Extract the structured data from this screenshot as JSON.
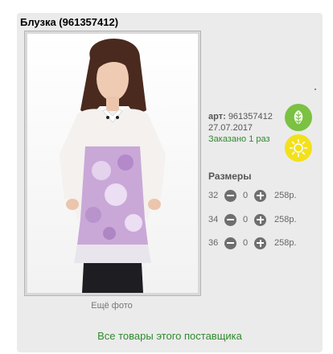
{
  "product": {
    "title": "Блузка (961357412)",
    "more_photos": "Ещё фото",
    "art_label": "арт:",
    "art_value": "961357412",
    "date": "27.07.2017",
    "ordered": "Заказано 1 раз"
  },
  "badges": [
    {
      "icon": "leaf-icon",
      "color": "#7bc142"
    },
    {
      "icon": "sun-icon",
      "color": "#f2e11a"
    }
  ],
  "sizes": {
    "title": "Размеры",
    "rows": [
      {
        "size": "32",
        "qty": "0",
        "price": "258р."
      },
      {
        "size": "34",
        "qty": "0",
        "price": "258р."
      },
      {
        "size": "36",
        "qty": "0",
        "price": "258р."
      }
    ]
  },
  "supplier_link": "Все товары этого поставщика"
}
